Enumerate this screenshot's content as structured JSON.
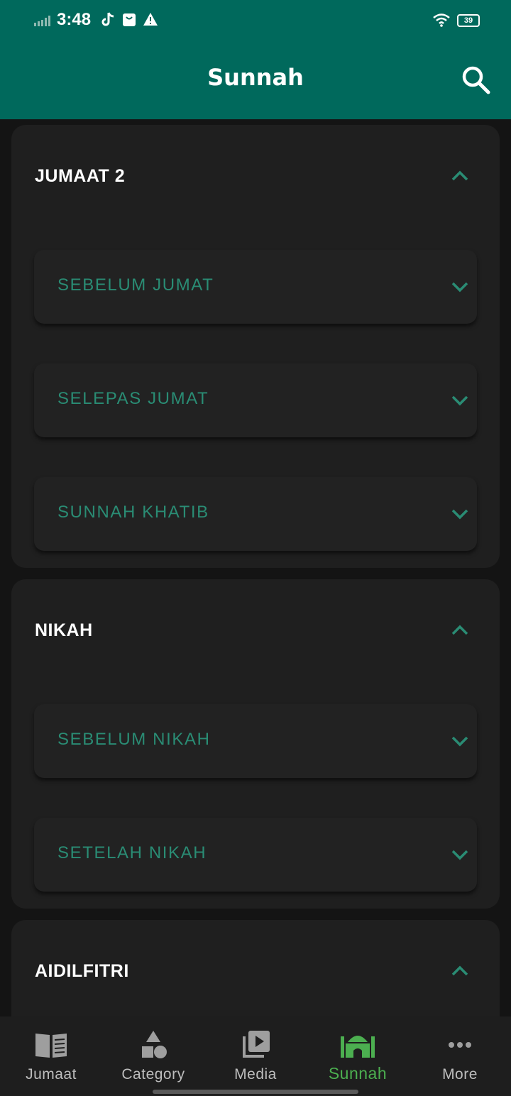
{
  "status_bar": {
    "time": "3:48",
    "battery": "39",
    "icons": [
      "signal-icon",
      "tiktok-icon",
      "bag-icon",
      "warning-icon",
      "wifi-icon",
      "battery-icon"
    ]
  },
  "app_bar": {
    "title": "Sunnah",
    "search_icon": "search-icon"
  },
  "sections": [
    {
      "title": "JUMAAT 2",
      "expanded": true,
      "items": [
        "SEBELUM JUMAT",
        "SELEPAS JUMAT",
        "SUNNAH KHATIB"
      ]
    },
    {
      "title": "NIKAH",
      "expanded": true,
      "items": [
        "SEBELUM NIKAH",
        "SETELAH NIKAH"
      ]
    },
    {
      "title": "AIDILFITRI",
      "expanded": true,
      "items": []
    }
  ],
  "bottom_nav": {
    "items": [
      {
        "label": "Jumaat",
        "icon": "book-icon"
      },
      {
        "label": "Category",
        "icon": "shapes-icon"
      },
      {
        "label": "Media",
        "icon": "video-library-icon"
      },
      {
        "label": "Sunnah",
        "icon": "mosque-icon",
        "active": true
      },
      {
        "label": "More",
        "icon": "more-dots-icon"
      }
    ]
  },
  "colors": {
    "primary": "#00695c",
    "accent_text": "#2a8c74",
    "active_nav": "#4caf50",
    "background": "#141414",
    "card": "#1f1f1f"
  }
}
